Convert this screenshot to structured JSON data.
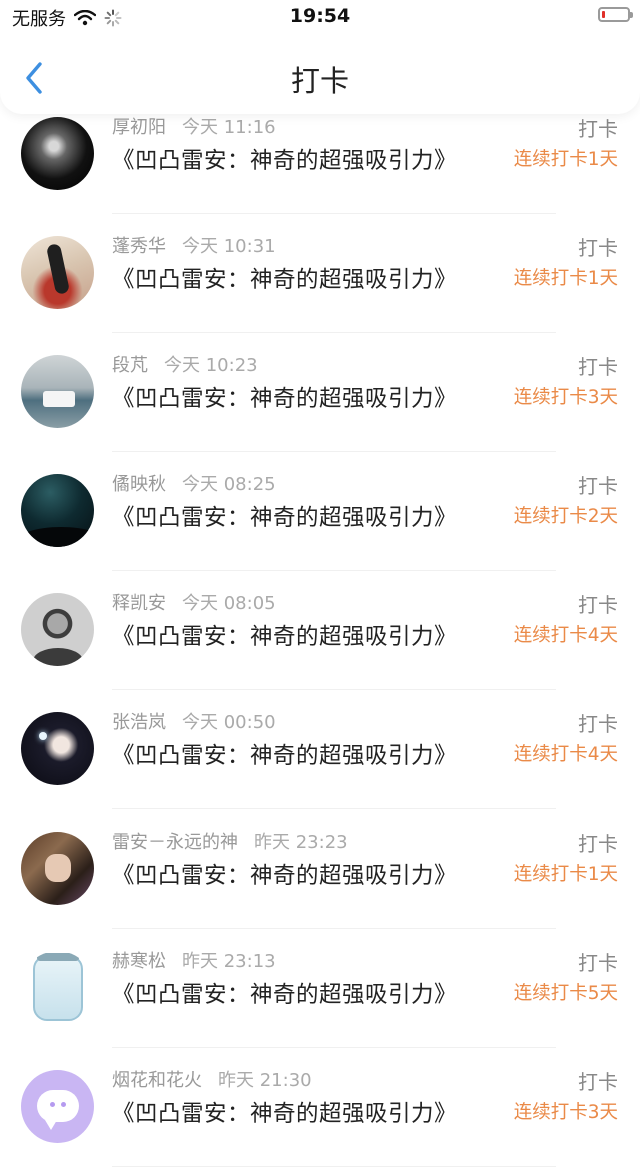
{
  "status_bar": {
    "carrier": "无服务",
    "time": "19:54"
  },
  "nav": {
    "title": "打卡"
  },
  "records": [
    {
      "name": "厚初阳",
      "time": "今天 11:16",
      "book": "《凹凸雷安：神奇的超强吸引力》",
      "action": "打卡",
      "streak": "连续打卡1天"
    },
    {
      "name": "蓬秀华",
      "time": "今天 10:31",
      "book": "《凹凸雷安：神奇的超强吸引力》",
      "action": "打卡",
      "streak": "连续打卡1天"
    },
    {
      "name": "段芃",
      "time": "今天 10:23",
      "book": "《凹凸雷安：神奇的超强吸引力》",
      "action": "打卡",
      "streak": "连续打卡3天"
    },
    {
      "name": "僪映秋",
      "time": "今天 08:25",
      "book": "《凹凸雷安：神奇的超强吸引力》",
      "action": "打卡",
      "streak": "连续打卡2天"
    },
    {
      "name": "释凯安",
      "time": "今天 08:05",
      "book": "《凹凸雷安：神奇的超强吸引力》",
      "action": "打卡",
      "streak": "连续打卡4天"
    },
    {
      "name": "张浩岚",
      "time": "今天 00:50",
      "book": "《凹凸雷安：神奇的超强吸引力》",
      "action": "打卡",
      "streak": "连续打卡4天"
    },
    {
      "name": "雷安－永远的神",
      "time": "昨天 23:23",
      "book": "《凹凸雷安：神奇的超强吸引力》",
      "action": "打卡",
      "streak": "连续打卡1天"
    },
    {
      "name": "赫寒松",
      "time": "昨天 23:13",
      "book": "《凹凸雷安：神奇的超强吸引力》",
      "action": "打卡",
      "streak": "连续打卡5天"
    },
    {
      "name": "烟花和花火",
      "time": "昨天 21:30",
      "book": "《凹凸雷安：神奇的超强吸引力》",
      "action": "打卡",
      "streak": "连续打卡3天"
    }
  ],
  "colors": {
    "streak": "#ea8a48",
    "back_arrow": "#3d8fe0"
  },
  "icons": {
    "back": "chevron-left-icon",
    "wifi": "wifi-icon",
    "loading": "loading-spinner-icon",
    "battery": "battery-low-icon"
  }
}
